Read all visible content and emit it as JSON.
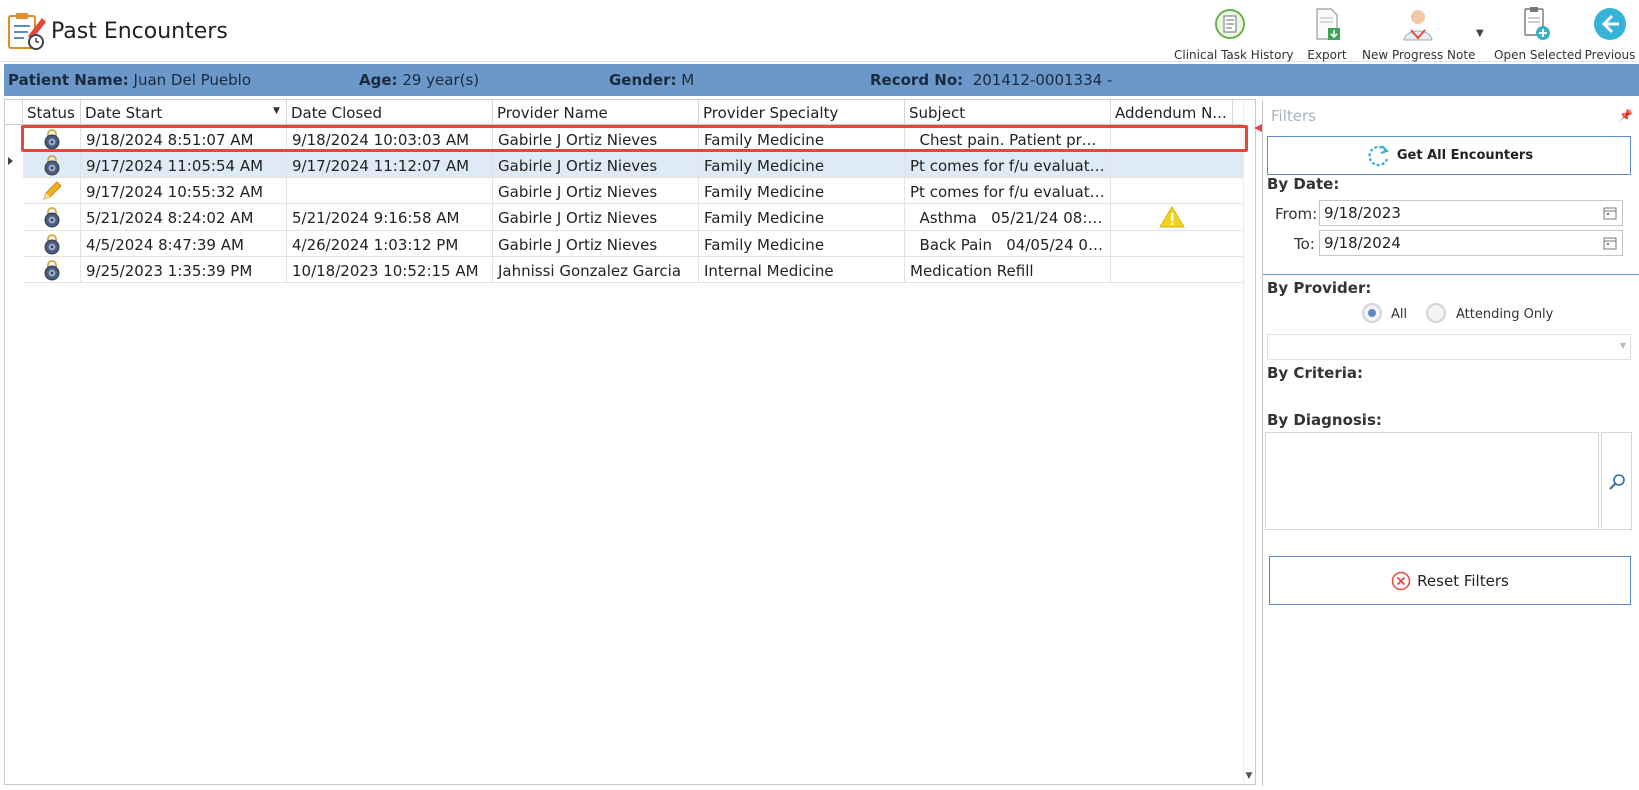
{
  "window": {
    "title": "Past Encounters"
  },
  "toolbar": [
    {
      "label": "Clinical Task History",
      "icon": "clinical-task-history-icon"
    },
    {
      "label": "Export",
      "icon": "export-icon"
    },
    {
      "label": "New Progress Note",
      "icon": "new-progress-note-icon"
    },
    {
      "label": "Open Selected",
      "icon": "open-selected-icon"
    },
    {
      "label": "Previous",
      "icon": "previous-arrow-icon"
    }
  ],
  "patient": {
    "name_label": "Patient Name:",
    "name": "Juan Del Pueblo",
    "age_label": "Age:",
    "age": "29 year(s)",
    "gender_label": "Gender:",
    "gender": "M",
    "record_label": "Record No:",
    "record": "201412-0001334 -"
  },
  "grid": {
    "columns": [
      "Status",
      "Date Start",
      "Date Closed",
      "Provider Name",
      "Provider Specialty",
      "Subject",
      "Addendum N..."
    ],
    "sorted_column": "Date Start",
    "rows": [
      {
        "status": "locked",
        "date_start": "9/18/2024 8:51:07 AM",
        "date_closed": "9/18/2024 10:03:03 AM",
        "provider": "Gabirle J Ortiz Nieves",
        "specialty": "Family Medicine",
        "subject": "  Chest pain. Patient prese...",
        "addendum": "",
        "highlighted": true
      },
      {
        "status": "locked",
        "date_start": "9/17/2024 11:05:54 AM",
        "date_closed": "9/17/2024 11:12:07 AM",
        "provider": "Gabirle J Ortiz Nieves",
        "specialty": "Family Medicine",
        "subject": "Pt comes for f/u evaluatio...",
        "addendum": "",
        "selected": true
      },
      {
        "status": "draft",
        "date_start": "9/17/2024 10:55:32 AM",
        "date_closed": "",
        "provider": "Gabirle J Ortiz Nieves",
        "specialty": "Family Medicine",
        "subject": "Pt comes for f/u evaluatio...",
        "addendum": ""
      },
      {
        "status": "locked",
        "date_start": "5/21/2024 8:24:02 AM",
        "date_closed": "5/21/2024 9:16:58 AM",
        "provider": "Gabirle J Ortiz Nieves",
        "specialty": "Family Medicine",
        "subject": "  Asthma   05/21/24 08:25:...",
        "addendum": "warning"
      },
      {
        "status": "locked",
        "date_start": "4/5/2024 8:47:39 AM",
        "date_closed": "4/26/2024 1:03:12 PM",
        "provider": "Gabirle J Ortiz Nieves",
        "specialty": "Family Medicine",
        "subject": "  Back Pain   04/05/24 08:...",
        "addendum": ""
      },
      {
        "status": "locked",
        "date_start": "9/25/2023 1:35:39 PM",
        "date_closed": "10/18/2023 10:52:15 AM",
        "provider": "Jahnissi Gonzalez Garcia",
        "specialty": "Internal Medicine",
        "subject": "Medication Refill",
        "addendum": ""
      }
    ]
  },
  "filters": {
    "title": "Filters",
    "get_all_label": "Get All Encounters",
    "by_date_label": "By Date:",
    "from_label": "From:",
    "from_value": "9/18/2023",
    "to_label": "To:",
    "to_value": "9/18/2024",
    "by_provider_label": "By Provider:",
    "radio_all_label": "All",
    "radio_attending_label": "Attending Only",
    "radio_selected": "All",
    "by_criteria_label": "By Criteria:",
    "by_diagnosis_label": "By Diagnosis:",
    "reset_label": "Reset Filters"
  },
  "colors": {
    "patient_bar": "#6c98c9",
    "accent": "#5d8cc5",
    "highlight": "#e4473c",
    "selected_row": "#dfeaf7",
    "warning": "#f2d21d"
  }
}
